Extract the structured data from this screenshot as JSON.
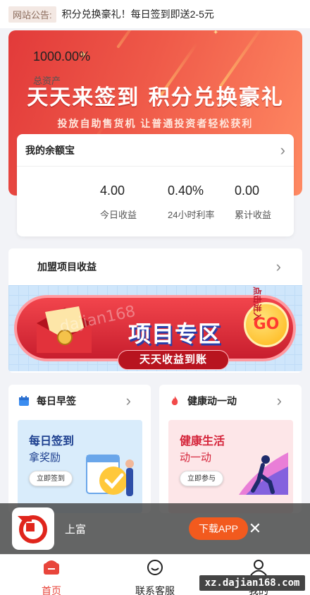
{
  "notice": {
    "tag": "网站公告:",
    "text": "积分兑换豪礼！每日签到即送2-5元"
  },
  "hero": {
    "title": "天天来签到 积分兑换豪礼",
    "subtitle": "投放自助售货机 让普通投资者轻松获利"
  },
  "yuebao": {
    "title": "我的余额宝",
    "stats": [
      {
        "value": "1000.00%",
        "label": "总资产"
      },
      {
        "value": "4.00",
        "label": "今日收益"
      },
      {
        "value": "0.40%",
        "label": "24小时利率"
      },
      {
        "value": "0.00",
        "label": "累计收益"
      }
    ]
  },
  "join": {
    "title": "加盟项目收益",
    "banner_title": "项目专区",
    "banner_sub": "天天收益到账",
    "go": "GO",
    "go_hint": "点击进入"
  },
  "morning": {
    "title": "每日早签",
    "body_title": "每日签到",
    "body_sub": "拿奖励",
    "button": "立即签到"
  },
  "health": {
    "title": "健康动一动",
    "body_title": "健康生活",
    "body_sub": "动一动",
    "button": "立即参与"
  },
  "app_bar": {
    "name": "上富",
    "download": "下载APP",
    "close": "✕"
  },
  "tabs": [
    {
      "label": "首页",
      "icon": "home-icon",
      "active": true
    },
    {
      "label": "联系客服",
      "icon": "service-icon",
      "active": false
    },
    {
      "label": "我的",
      "icon": "user-icon",
      "active": false
    }
  ],
  "site_badge": "xz.dajian168.com",
  "colors": {
    "brand": "#e8453b",
    "download": "#f25a1e",
    "active_tab": "#e8453b"
  }
}
